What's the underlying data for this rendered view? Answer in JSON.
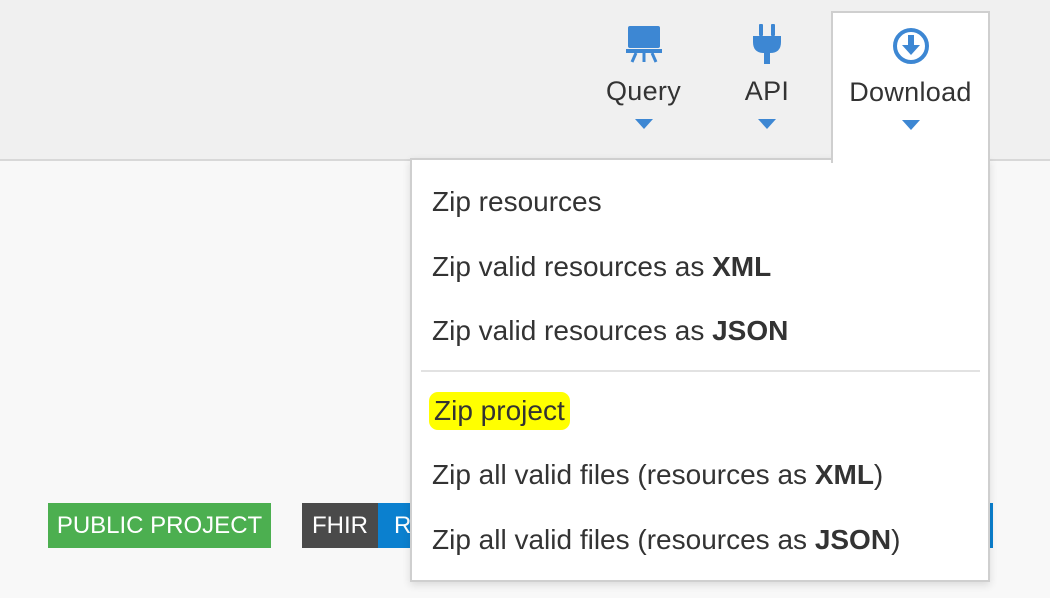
{
  "nav": {
    "query": {
      "label": "Query",
      "icon": "monitor-icon"
    },
    "api": {
      "label": "API",
      "icon": "plug-icon"
    },
    "download": {
      "label": "Download",
      "icon": "download-circle-icon"
    }
  },
  "download_menu": {
    "items": [
      {
        "text": "Zip resources"
      },
      {
        "text": "Zip valid resources as ",
        "bold": "XML"
      },
      {
        "text": "Zip valid resources as ",
        "bold": "JSON"
      },
      {
        "text": "Zip project",
        "highlighted": true
      },
      {
        "text": "Zip all valid files (resources as ",
        "bold": "XML",
        "suffix": ")"
      },
      {
        "text": "Zip all valid files (resources as ",
        "bold": "JSON",
        "suffix": ")"
      }
    ]
  },
  "badges": {
    "public": "PUBLIC PROJECT",
    "fhir": "FHIR",
    "release_partial": "R"
  },
  "colors": {
    "accent_blue": "#3d87d3",
    "public_green": "#4caf50",
    "fhir_dark": "#4a4a4a",
    "release_blue": "#0b80cf",
    "highlight_yellow": "#ffff00"
  }
}
